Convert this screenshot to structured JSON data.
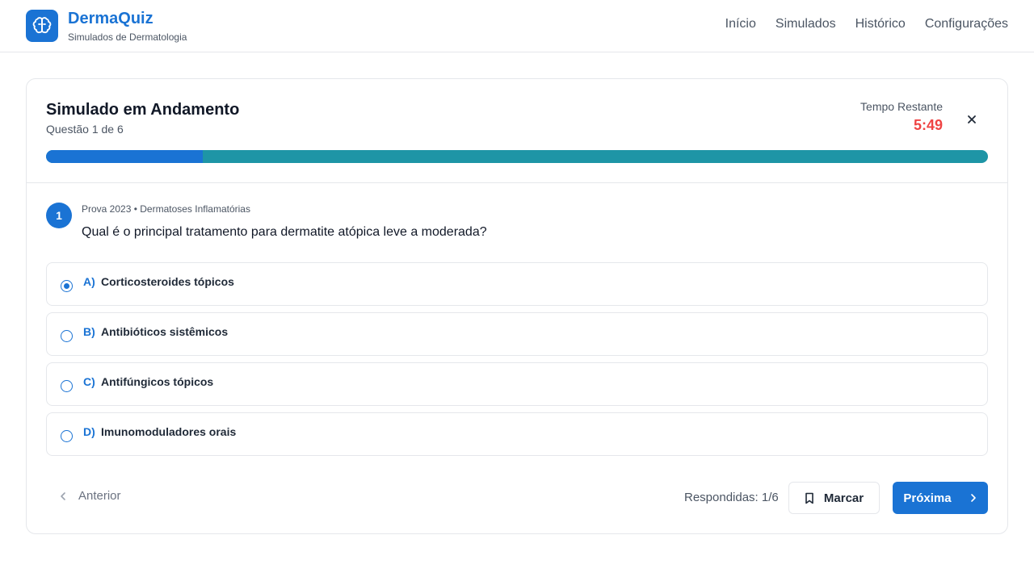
{
  "app": {
    "name": "DermaQuiz",
    "subtitle": "Simulados de Dermatologia",
    "logo_icon": "brain-icon",
    "accent_color": "#1a73d4"
  },
  "nav": {
    "items": [
      {
        "label": "Início"
      },
      {
        "label": "Simulados"
      },
      {
        "label": "Histórico"
      },
      {
        "label": "Configurações"
      }
    ]
  },
  "quiz": {
    "title": "Simulado em Andamento",
    "progress_text": "Questão 1 de 6",
    "timer_label": "Tempo Restante",
    "timer_value": "5:49",
    "progress_fraction": 0.1667
  },
  "question": {
    "number": "1",
    "meta": "Prova 2023 • Dermatoses Inflamatórias",
    "text": "Qual é o principal tratamento para dermatite atópica leve a moderada?",
    "options": [
      {
        "letter": "A)",
        "text": "Corticosteroides tópicos",
        "selected": true
      },
      {
        "letter": "B)",
        "text": "Antibióticos sistêmicos",
        "selected": false
      },
      {
        "letter": "C)",
        "text": "Antifúngicos tópicos",
        "selected": false
      },
      {
        "letter": "D)",
        "text": "Imunomoduladores orais",
        "selected": false
      }
    ]
  },
  "footer": {
    "prev_label": "Anterior",
    "answered_text": "Respondidas: 1/6",
    "mark_label": "Marcar",
    "next_label": "Próxima"
  }
}
